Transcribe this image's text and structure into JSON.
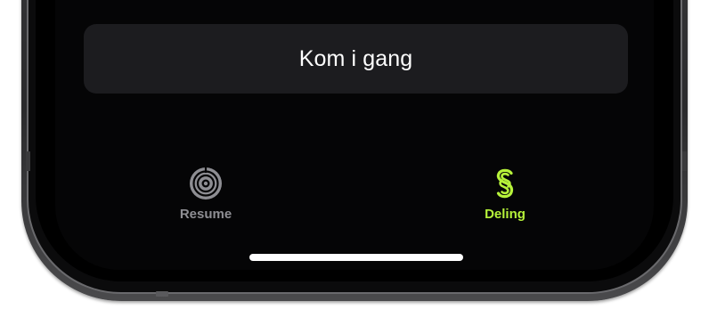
{
  "cta": {
    "label": "Kom i gang"
  },
  "tabbar": {
    "items": [
      {
        "label": "Resume",
        "icon": "target-rings-icon",
        "active": false,
        "color": "#8e8e93"
      },
      {
        "label": "Deling",
        "icon": "share-loop-icon",
        "active": true,
        "color": "#b6f23a"
      }
    ]
  },
  "colors": {
    "screen_background": "#050506",
    "button_background": "#1c1c1f",
    "accent": "#b6f23a",
    "inactive": "#8e8e93"
  }
}
